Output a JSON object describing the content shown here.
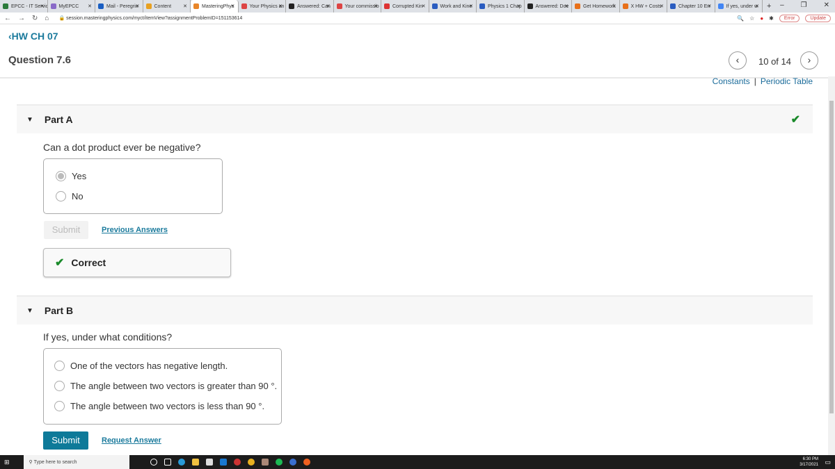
{
  "browser": {
    "tabs": [
      {
        "label": "EPCC - IT Servic",
        "color": "#2b7a3b"
      },
      {
        "label": "MyEPCC",
        "color": "#8a6ac8"
      },
      {
        "label": "Mail - Peregrin",
        "color": "#1a5ec2"
      },
      {
        "label": "Content",
        "color": "#e8a020"
      },
      {
        "label": "MasteringPhys",
        "color": "#e8862a",
        "active": true
      },
      {
        "label": "Your Physics an",
        "color": "#d44"
      },
      {
        "label": "Answered: Can",
        "color": "#222"
      },
      {
        "label": "Your commissio",
        "color": "#d44"
      },
      {
        "label": "Corrupted Kin",
        "color": "#d33"
      },
      {
        "label": "Work and Kine",
        "color": "#2a5cc0"
      },
      {
        "label": "Physics 1 Chap",
        "color": "#2a5cc0"
      },
      {
        "label": "Answered: Doe",
        "color": "#222"
      },
      {
        "label": "Get Homework",
        "color": "#e8701a"
      },
      {
        "label": "X HW + Costs",
        "color": "#e8701a"
      },
      {
        "label": "Chapter 10 Err",
        "color": "#2a5cc0"
      },
      {
        "label": "If yes, under w",
        "color": "#4285f4"
      }
    ],
    "url": "session.masteringphysics.com/myct/itemView?assignmentProblemID=151153614",
    "error_label": "Error",
    "update_label": "Update"
  },
  "header": {
    "back_label": "HW CH 07",
    "question_title": "Question 7.6",
    "position": "10 of 14",
    "constants": "Constants",
    "periodic_table": "Periodic Table",
    "separator": "|"
  },
  "partA": {
    "label": "Part A",
    "question": "Can a dot product ever be negative?",
    "options": [
      "Yes",
      "No"
    ],
    "selected": 0,
    "submit": "Submit",
    "previous_answers": "Previous Answers",
    "feedback": "Correct",
    "completed": true
  },
  "partB": {
    "label": "Part B",
    "question": "If yes, under what conditions?",
    "options": [
      "One of the vectors has negative length.",
      "The angle between two vectors is greater than 90 °.",
      "The angle between two vectors is less than 90 °."
    ],
    "submit": "Submit",
    "request_answer": "Request Answer"
  },
  "taskbar": {
    "search_placeholder": "Type here to search",
    "time": "6:30 PM",
    "date": "3/17/2021"
  },
  "colors": {
    "accent": "#0e7a99",
    "link": "#1a7a9c",
    "success": "#1a8a2a"
  }
}
